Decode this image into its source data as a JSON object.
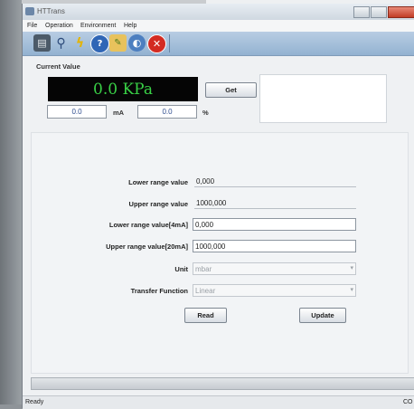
{
  "window": {
    "title": "HTTrans"
  },
  "menu": [
    "File",
    "Operation",
    "Environment",
    "Help"
  ],
  "toolbar": {
    "icons": [
      "device-icon",
      "search-icon",
      "lightning-icon",
      "help-icon",
      "folder-icon",
      "globe-icon",
      "close-icon"
    ],
    "glyphs": [
      "▤",
      "⚲",
      "ϟ",
      "?",
      "✎",
      "◐",
      "✕"
    ]
  },
  "current_value": {
    "label": "Current Value",
    "display": "0.0  KPa",
    "get_button": "Get",
    "ma_value": "0.0",
    "ma_unit": "mA",
    "pct_value": "0.0",
    "pct_unit": "%"
  },
  "config": {
    "lower_range_label": "Lower range value",
    "lower_range_value": "0,000",
    "upper_range_label": "Upper range value",
    "upper_range_value": "1000,000",
    "lower_4ma_label": "Lower range value[4mA]",
    "lower_4ma_value": "0,000",
    "upper_20ma_label": "Upper range value[20mA]",
    "upper_20ma_value": "1000,000",
    "unit_label": "Unit",
    "unit_value": "mbar",
    "transfer_label": "Transfer Function",
    "transfer_value": "Linear",
    "read_button": "Read",
    "update_button": "Update"
  },
  "status": {
    "left": "Ready",
    "right": "CO"
  }
}
